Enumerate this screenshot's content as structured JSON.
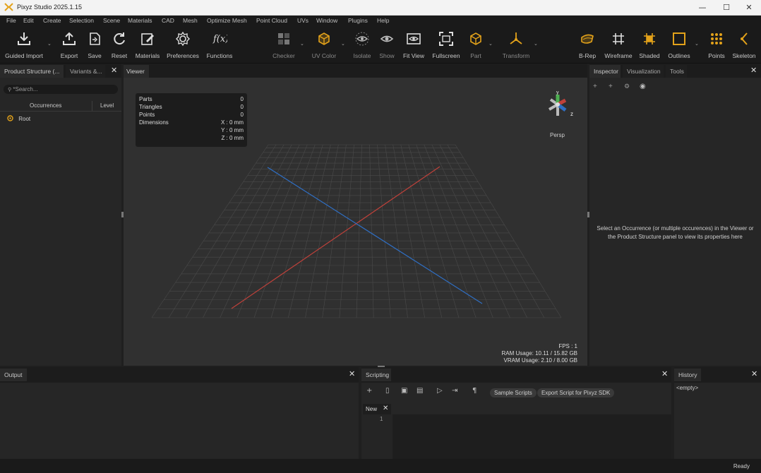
{
  "app": {
    "title": "Pixyz Studio 2025.1.15"
  },
  "window_controls": {
    "minimize": "—",
    "maximize": "☐",
    "close": "✕"
  },
  "menu": [
    "File",
    "Edit",
    "Create",
    "Selection",
    "Scene",
    "Materials",
    "CAD",
    "Mesh",
    "Optimize Mesh",
    "Point Cloud",
    "UVs",
    "Window",
    "Plugins",
    "Help"
  ],
  "toolbar": {
    "guided_import": "Guided Import",
    "export": "Export",
    "save": "Save",
    "reset": "Reset",
    "materials": "Materials",
    "preferences": "Preferences",
    "functions": "Functions",
    "checker": "Checker",
    "uv_color": "UV Color",
    "isolate": "Isolate",
    "show": "Show",
    "fit_view": "Fit View",
    "fullscreen": "Fullscreen",
    "part": "Part",
    "transform": "Transform",
    "brep": "B-Rep",
    "wireframe": "Wireframe",
    "shaded": "Shaded",
    "outlines": "Outlines",
    "points": "Points",
    "skeleton": "Skeleton"
  },
  "left_panel": {
    "tabs": [
      "Product Structure (...",
      "Variants &..."
    ],
    "search_placeholder": "*Search...",
    "columns": {
      "occurrences": "Occurrences",
      "level": "Level"
    },
    "root": "Root"
  },
  "viewer": {
    "tab": "Viewer",
    "stats": [
      {
        "label": "Parts",
        "value": "0"
      },
      {
        "label": "Triangles",
        "value": "0"
      },
      {
        "label": "Points",
        "value": "0"
      }
    ],
    "dimensions": {
      "label": "Dimensions",
      "x": "X : 0 mm",
      "y": "Y : 0 mm",
      "z": "Z : 0 mm"
    },
    "camera": "Persp",
    "axis_labels": {
      "y": "y",
      "z": "z"
    },
    "fps": "FPS : 1",
    "ram": "RAM Usage: 10.11 / 15.82 GB",
    "vram": "VRAM Usage: 2.10 / 8.00 GB"
  },
  "inspector": {
    "tabs": [
      "Inspector",
      "Visualization",
      "Tools"
    ],
    "message_line1": "Select an Occurrence (or multiple occurences) in the Viewer or",
    "message_line2": "the Product Structure panel to view its properties here"
  },
  "output": {
    "tab": "Output"
  },
  "scripting": {
    "tab": "Scripting",
    "sample_scripts": "Sample Scripts",
    "export_script": "Export Script for Pixyz SDK",
    "editor_tab": "New",
    "line_number": "1"
  },
  "history": {
    "tab": "History",
    "empty": "<empty>"
  },
  "status": {
    "text": "Ready"
  },
  "colors": {
    "accent": "#f5a623",
    "x_axis": "#c0413a",
    "z_axis": "#2f6fc4",
    "grid": "#4a4a4a"
  }
}
